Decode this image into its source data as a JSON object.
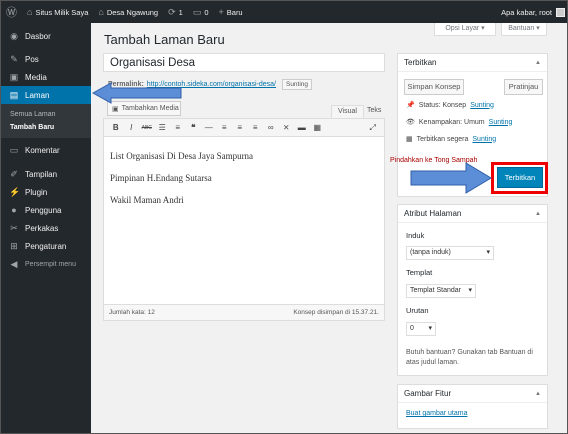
{
  "adminbar": {
    "site_name": "Situs Milik Saya",
    "site2_name": "Desa Ngawung",
    "updates_count": "1",
    "comments_count": "0",
    "new_label": "Baru",
    "greeting": "Apa kabar, root"
  },
  "sidebar": {
    "items": [
      {
        "label": "Dasbor",
        "icon": "dashboard-icon"
      },
      {
        "label": "Pos",
        "icon": "pin-icon"
      },
      {
        "label": "Media",
        "icon": "media-icon"
      },
      {
        "label": "Laman",
        "icon": "page-icon"
      },
      {
        "label": "Komentar",
        "icon": "comment-icon"
      },
      {
        "label": "Tampilan",
        "icon": "brush-icon"
      },
      {
        "label": "Plugin",
        "icon": "plugin-icon"
      },
      {
        "label": "Pengguna",
        "icon": "user-icon"
      },
      {
        "label": "Perkakas",
        "icon": "wrench-icon"
      },
      {
        "label": "Pengaturan",
        "icon": "settings-icon"
      },
      {
        "label": "Persempit menu",
        "icon": "collapse-icon"
      }
    ],
    "submenu": [
      "Semua Laman",
      "Tambah Baru"
    ]
  },
  "screen_options": "Opsi Layar",
  "help": "Bantuan",
  "page_title": "Tambah Laman Baru",
  "post_title": "Organisasi Desa",
  "permalink": {
    "label": "Permalink:",
    "url": "http://contoh.sideka.com/organisasi-desa/",
    "edit": "Sunting"
  },
  "add_media": "Tambahkan Media",
  "tabs": {
    "visual": "Visual",
    "text": "Teks"
  },
  "content_lines": [
    "List Organisasi Di Desa Jaya Sampurna",
    "Pimpinan H.Endang Sutarsa",
    "Wakil Maman Andri"
  ],
  "status_bar": {
    "word_count": "Jumlah kata: 12",
    "saved": "Konsep disimpan di 15.37.21."
  },
  "publish": {
    "title": "Terbitkan",
    "save_draft": "Simpan Konsep",
    "preview": "Pratinjau",
    "status_label": "Status: Konsep",
    "status_edit": "Sunting",
    "visibility_label": "Kenampakan: Umum",
    "visibility_edit": "Sunting",
    "schedule_label": "Terbitkan segera",
    "schedule_edit": "Sunting",
    "trash": "Pindahkan ke Tong Sampah",
    "publish_button": "Terbitkan"
  },
  "page_attributes": {
    "title": "Atribut Halaman",
    "parent_label": "Induk",
    "parent_value": "(tanpa induk)",
    "template_label": "Templat",
    "template_value": "Templat Standar",
    "order_label": "Urutan",
    "order_value": "0",
    "help_text": "Butuh bantuan? Gunakan tab Bantuan di atas judul laman."
  },
  "featured_image": {
    "title": "Gambar Fitur",
    "set_link": "Buat gambar utama"
  },
  "colors": {
    "accent": "#0073aa",
    "highlight_border": "#e00000",
    "arrow_fill": "#5b8ed6"
  }
}
